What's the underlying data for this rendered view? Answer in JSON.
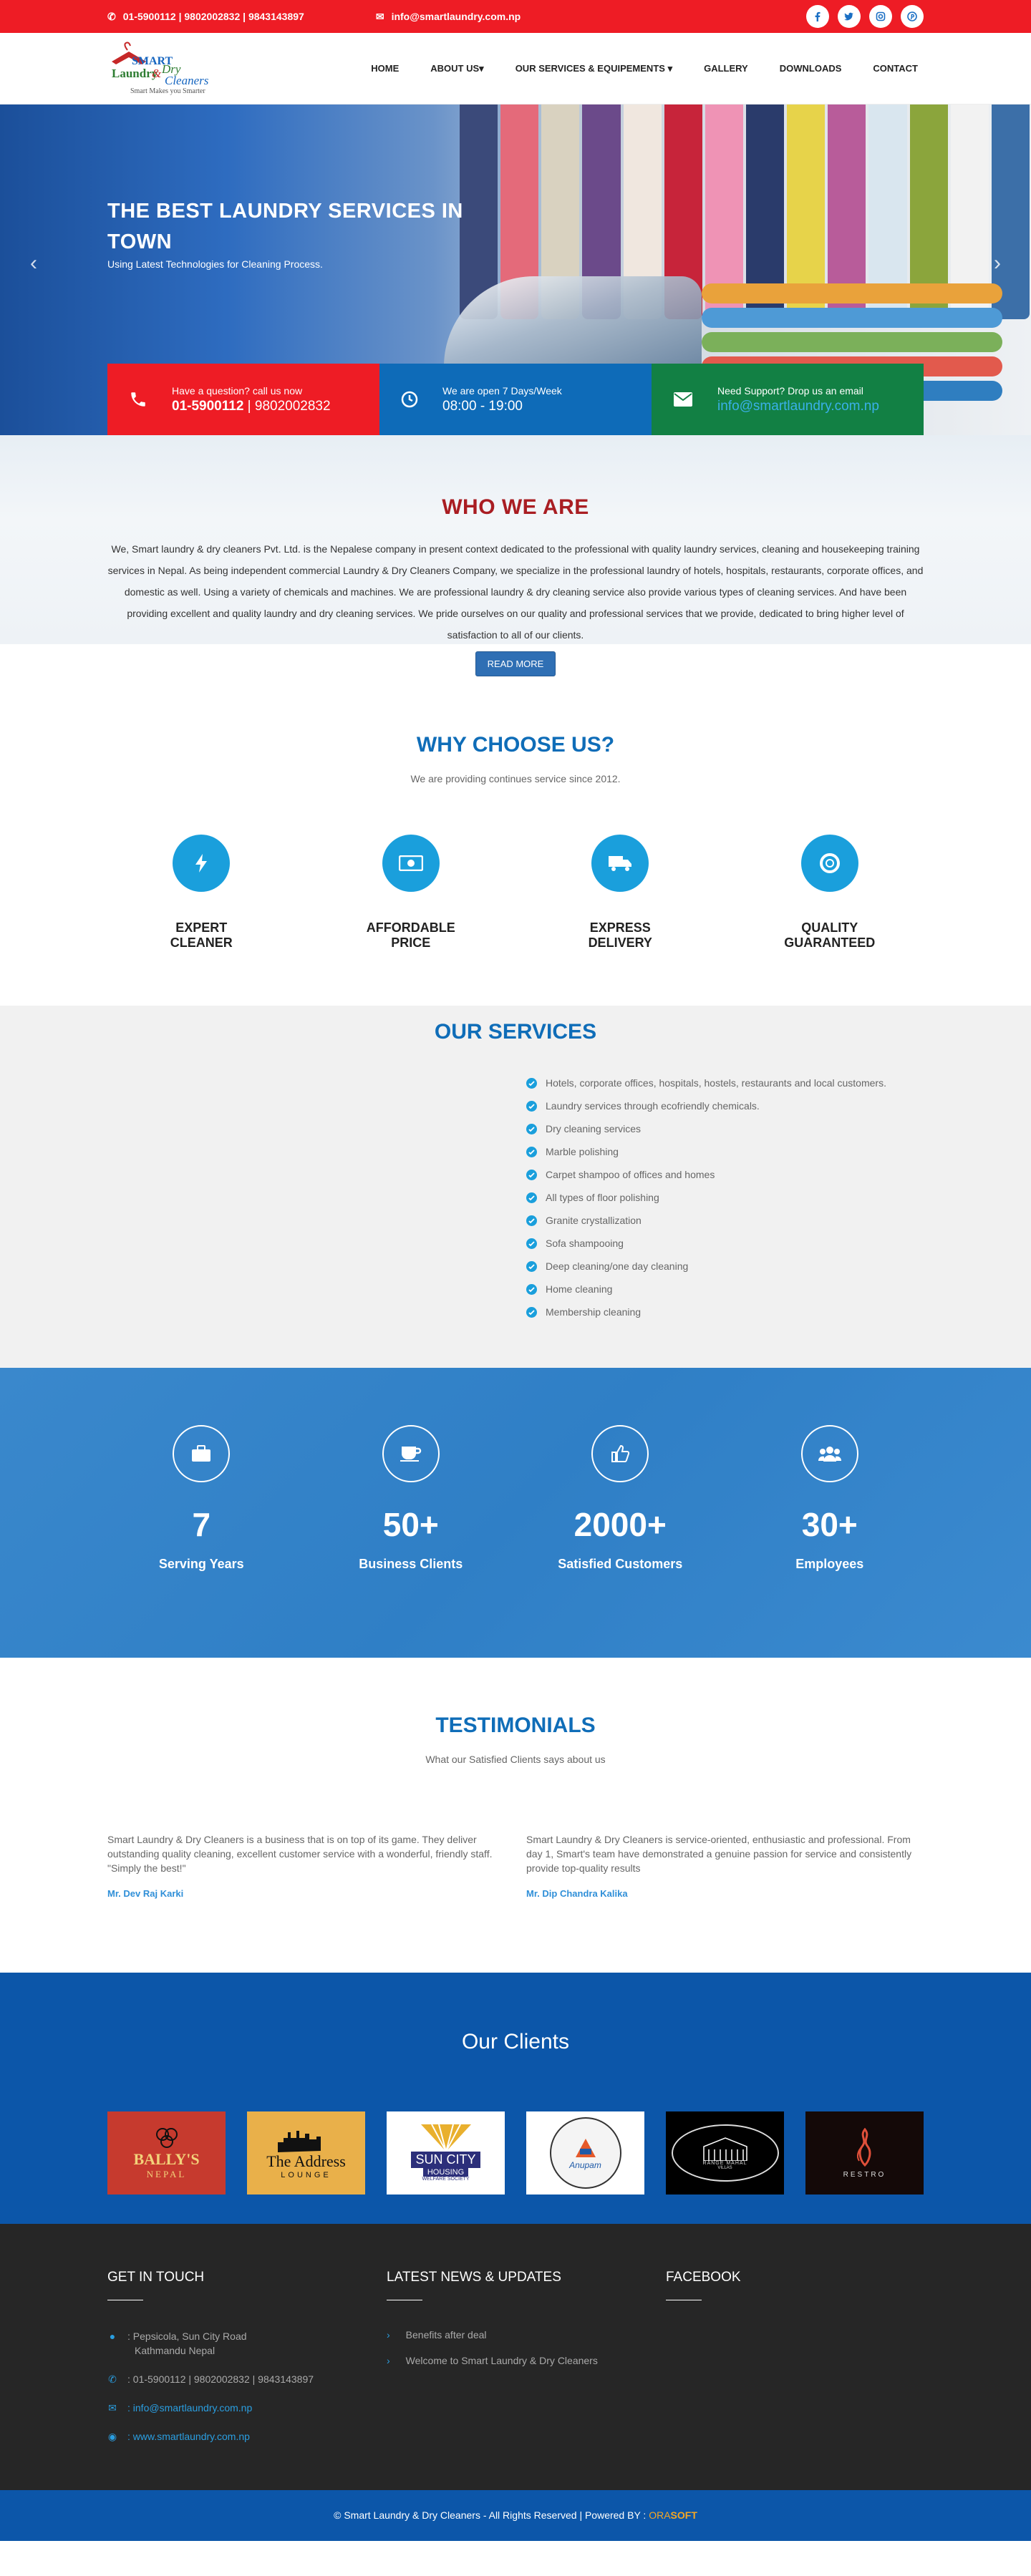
{
  "topbar": {
    "phone": "01-5900112 | 9802002832 | 9843143897",
    "email": "info@smartlaundry.com.np",
    "social": [
      "facebook-icon",
      "twitter-icon",
      "instagram-icon",
      "pinterest-icon"
    ]
  },
  "logo": {
    "line1": "SMART",
    "line2a": "Laundry",
    "line2b": "&",
    "line2c": "Dry",
    "line3": "Cleaners",
    "tagline": "Smart Makes you Smarter"
  },
  "nav": [
    "HOME",
    "ABOUT US",
    "OUR SERVICES & EQUIPEMENTS",
    "GALLERY",
    "DOWNLOADS",
    "CONTACT"
  ],
  "hero": {
    "title": "THE BEST LAUNDRY SERVICES IN TOWN",
    "subtitle": "Using Latest Technologies for Cleaning Process.",
    "boxes": [
      {
        "l1": "Have a question? call us now",
        "l2a": "01-5900112",
        "l2b": " | 9802002832"
      },
      {
        "l1": "We are open 7 Days/Week",
        "l2": "08:00 - 19:00"
      },
      {
        "l1": "Need Support? Drop us an email",
        "l2": "info@smartlaundry.com.np"
      }
    ]
  },
  "who": {
    "title": "WHO WE ARE",
    "text": "We, Smart laundry & dry cleaners Pvt. Ltd. is the Nepalese company in present context dedicated to the professional with quality laundry services, cleaning and housekeeping training services in Nepal. As being independent commercial Laundry & Dry Cleaners Company, we specialize in the professional laundry of hotels, hospitals, restaurants, corporate offices, and domestic as well. Using a variety of chemicals and machines. We are professional laundry & dry cleaning service also provide various types of cleaning services. And have been providing excellent and quality laundry and dry cleaning services. We pride ourselves on our quality and professional services that we provide, dedicated to bring higher level of satisfaction to all of our clients.",
    "button": "READ MORE"
  },
  "why": {
    "title": "WHY CHOOSE US?",
    "subtitle": "We are providing continues service since 2012.",
    "items": [
      {
        "label": "EXPERT CLEANER",
        "icon": "bolt-icon"
      },
      {
        "label": "AFFORDABLE PRICE",
        "icon": "money-icon"
      },
      {
        "label": "EXPRESS DELIVERY",
        "icon": "truck-icon"
      },
      {
        "label": "QUALITY GUARANTEED",
        "icon": "lifebuoy-icon"
      }
    ]
  },
  "services": {
    "title": "OUR SERVICES",
    "items": [
      "Hotels, corporate offices, hospitals, hostels, restaurants and local customers.",
      "Laundry services through ecofriendly chemicals.",
      "Dry cleaning services",
      "Marble polishing",
      "Carpet shampoo of offices and homes",
      "All types of floor polishing",
      "Granite crystallization",
      "Sofa shampooing",
      "Deep cleaning/one day cleaning",
      "Home cleaning",
      "Membership cleaning"
    ]
  },
  "stats": [
    {
      "num": "7",
      "label": "Serving Years",
      "icon": "briefcase-icon"
    },
    {
      "num": "50+",
      "label": "Business Clients",
      "icon": "coffee-icon"
    },
    {
      "num": "2000+",
      "label": "Satisfied Customers",
      "icon": "thumbs-up-icon"
    },
    {
      "num": "30+",
      "label": "Employees",
      "icon": "users-icon"
    }
  ],
  "testimonials": {
    "title": "TESTIMONIALS",
    "subtitle": "What our Satisfied Clients says about us",
    "items": [
      {
        "text": "Smart Laundry & Dry Cleaners is a business that is on top of its game. They deliver outstanding quality cleaning, excellent customer service with a wonderful, friendly staff. \"Simply the best!\"",
        "name": "Mr. Dev Raj Karki"
      },
      {
        "text": "Smart Laundry & Dry Cleaners is service-oriented, enthusiastic and professional. From day 1, Smart's team have demonstrated a genuine passion for service and consistently provide top-quality results",
        "name": "Mr. Dip Chandra Kalika"
      }
    ]
  },
  "clients": {
    "title": "Our Clients",
    "logos": [
      {
        "name": "BALLY'S",
        "sub": "NEPAL"
      },
      {
        "name": "The Address",
        "sub": "LOUNGE"
      },
      {
        "name": "SUN CITY",
        "sub": "HOUSING",
        "sub2": "WELFARE SOCIETY"
      },
      {
        "name": "Anupam",
        "sub": ""
      },
      {
        "name": "RANGE MAHAL",
        "sub": "VILLAS"
      },
      {
        "name": "RESTRO",
        "sub": ""
      }
    ]
  },
  "footer": {
    "contact_title": "GET IN TOUCH",
    "address1": ": Pepsicola, Sun City Road",
    "address2": "Kathmandu Nepal",
    "phone": ": 01-5900112 | 9802002832 | 9843143897",
    "email": ": info@smartlaundry.com.np",
    "web": ": www.smartlaundry.com.np",
    "news_title": "LATEST NEWS & UPDATES",
    "news": [
      "Benefits after deal",
      "Welcome to Smart Laundry & Dry Cleaners"
    ],
    "fb_title": "FACEBOOK"
  },
  "copyright": {
    "text": "© Smart Laundry & Dry Cleaners - All Rights Reserved | Powered BY : ",
    "brand1": "ORA",
    "brand2": "SOFT"
  }
}
